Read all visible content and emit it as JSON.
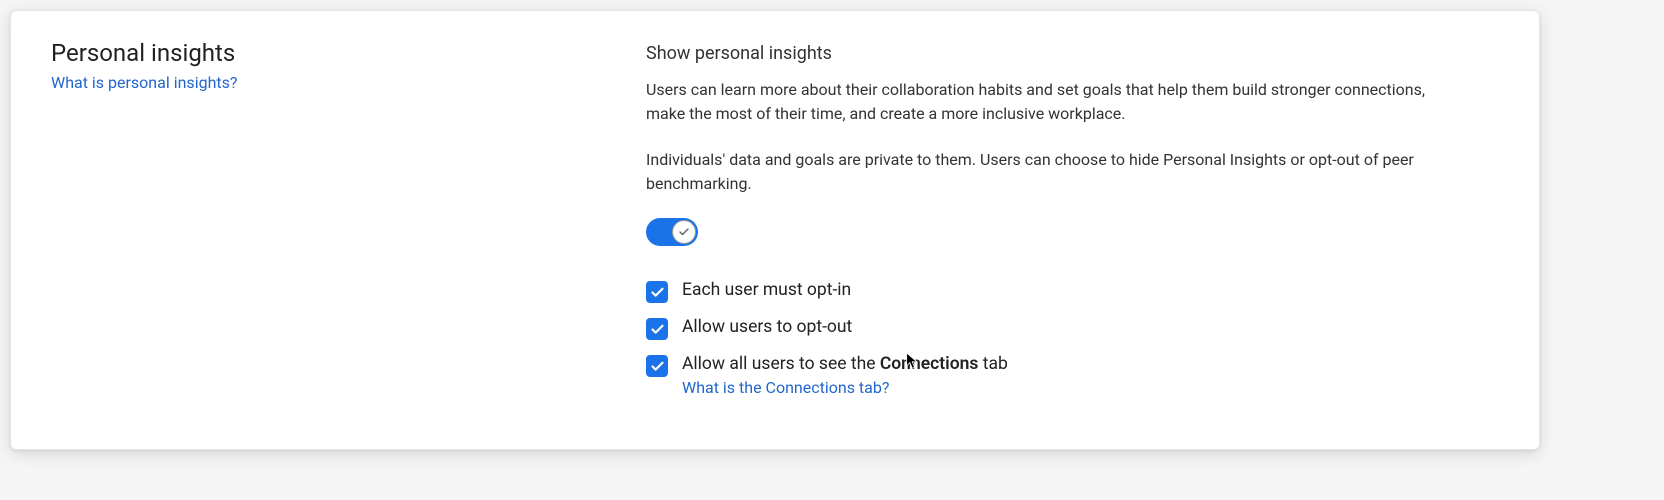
{
  "left": {
    "title": "Personal insights",
    "help_link": "What is personal insights?"
  },
  "right": {
    "heading": "Show personal insights",
    "paragraph1": "Users can learn more about their collaboration habits and set goals that help them build stronger connections, make the most of their time, and create a more inclusive workplace.",
    "paragraph2": "Individuals' data and goals are private to them. Users can choose to hide Personal Insights or opt-out of peer benchmarking.",
    "toggle_on": true,
    "checkboxes": [
      {
        "checked": true,
        "label": "Each user must opt-in"
      },
      {
        "checked": true,
        "label": "Allow users to opt-out"
      },
      {
        "checked": true,
        "label_prefix": "Allow all users to see the ",
        "label_bold": "Connections",
        "label_suffix": " tab",
        "sublink": "What is the Connections tab?"
      }
    ]
  }
}
